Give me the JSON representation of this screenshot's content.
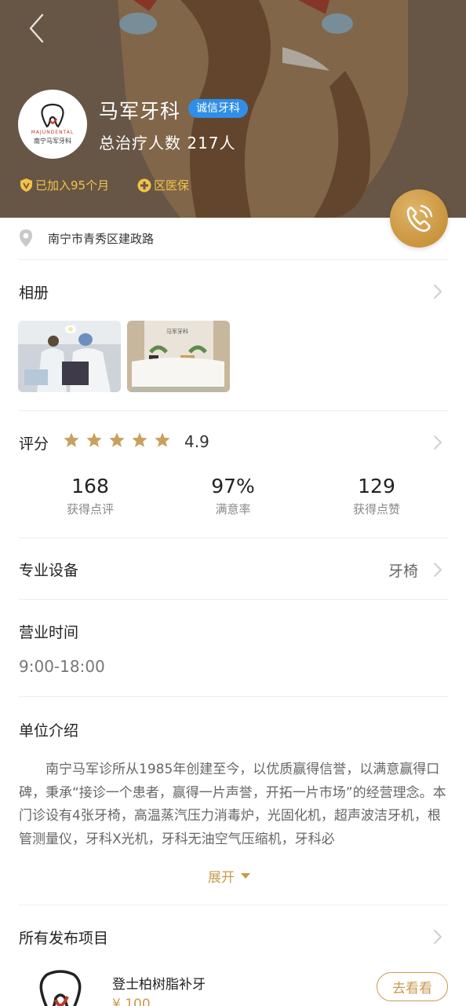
{
  "header": {
    "clinic_name": "马军牙科",
    "badge": "诚信牙科",
    "treated": "总治疗人数 217人",
    "joined": "已加入95个月",
    "insurance": "区医保",
    "logo_en": "MAJUNDENTAL",
    "logo_cn": "南宁马军牙科"
  },
  "address": "南宁市青秀区建政路",
  "album": {
    "title": "相册",
    "photos": [
      "dental-treatment-photo",
      "reception-desk-photo"
    ]
  },
  "rating": {
    "title": "评分",
    "stars": 5,
    "score": "4.9",
    "stats": [
      {
        "num": "168",
        "label": "获得点评"
      },
      {
        "num": "97%",
        "label": "满意率"
      },
      {
        "num": "129",
        "label": "获得点赞"
      }
    ]
  },
  "equipment": {
    "title": "专业设备",
    "value": "牙椅"
  },
  "hours": {
    "title": "营业时间",
    "value": "9:00-18:00"
  },
  "intro": {
    "title": "单位介绍",
    "text": "南宁马军诊所从1985年创建至今，以优质赢得信誉，以满意赢得口碑，秉承“接诊一个患者，赢得一片声誉，开拓一片市场”的经营理念。本门诊设有4张牙椅，高温蒸汽压力消毒炉，光固化机，超声波洁牙机，根管测量仪，牙科X光机，牙科无油空气压缩机，牙科必",
    "expand": "展开"
  },
  "projects": {
    "title": "所有发布项目",
    "items": [
      {
        "name": "登士柏树脂补牙",
        "price": "¥ 100",
        "button": "去看看"
      }
    ]
  },
  "colors": {
    "gold": "#c89a4e",
    "badge_blue": "#2f8fe6",
    "star": "#c9a15d",
    "call_button": "#d2a352"
  }
}
